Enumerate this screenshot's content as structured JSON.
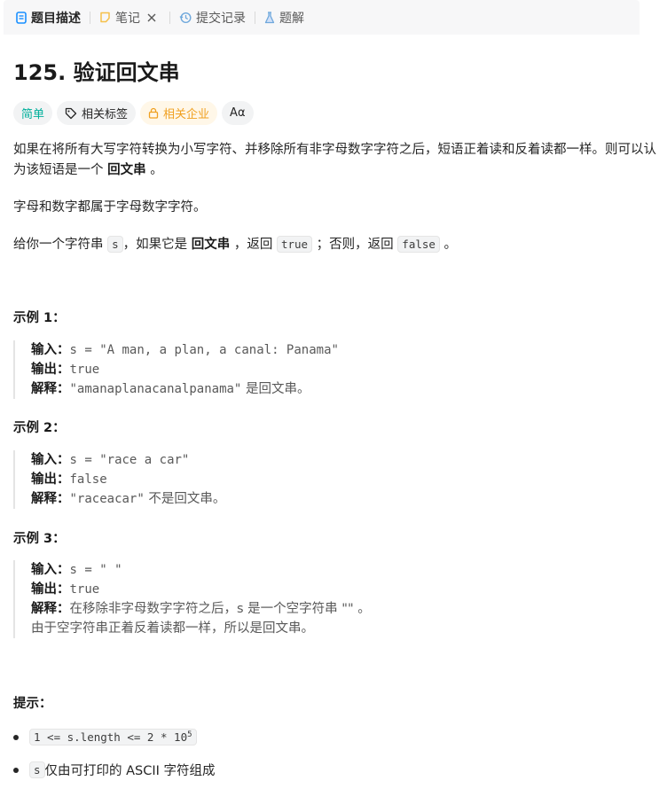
{
  "tabs": [
    {
      "label": "题目描述",
      "icon": "document-icon",
      "active": true
    },
    {
      "label": "笔记",
      "icon": "note-icon",
      "closable": true
    },
    {
      "label": "提交记录",
      "icon": "history-icon"
    },
    {
      "label": "题解",
      "icon": "flask-icon"
    }
  ],
  "problem": {
    "title": "125. 验证回文串",
    "tags": {
      "difficulty": "简单",
      "related_tags": "相关标签",
      "related_companies": "相关企业",
      "translate_icon": "Aα"
    },
    "desc1_part1": "如果在将所有大写字符转换为小写字符、并移除所有非字母数字字符之后，短语正着读和反着读都一样。则可以认为该短语是一个 ",
    "desc1_bold": "回文串",
    "desc1_end": " 。",
    "desc2": "字母和数字都属于字母数字字符。",
    "desc3_part1": "给你一个字符串 ",
    "desc3_code1": "s",
    "desc3_part2": "，如果它是 ",
    "desc3_bold": "回文串",
    "desc3_part3": " ，返回 ",
    "desc3_code2": "true",
    "desc3_part4": " ；否则，返回 ",
    "desc3_code3": "false",
    "desc3_end": " 。"
  },
  "labels": {
    "input": "输入：",
    "output": "输出：",
    "explain": "解释："
  },
  "examples": [
    {
      "title": "示例 1：",
      "input": "s = \"A man, a plan, a canal: Panama\"",
      "output": "true",
      "explain_code": "\"amanaplanacanalpanama\"",
      "explain_text": " 是回文串。"
    },
    {
      "title": "示例 2：",
      "input": "s = \"race a car\"",
      "output": "false",
      "explain_code": "\"raceacar\"",
      "explain_text": " 不是回文串。"
    },
    {
      "title": "示例 3：",
      "input": "s = \" \"",
      "output": "true",
      "explain_text1": "在移除非字母数字字符之后，s 是一个空字符串 \"\" 。",
      "explain_text2": "由于空字符串正着反着读都一样，所以是回文串。"
    }
  ],
  "hints": {
    "title": "提示：",
    "item1_code": "1 <= s.length <= 2 * 10",
    "item1_sup": "5",
    "item2_code": "s",
    "item2_text": " 仅由可打印的 ASCII 字符组成"
  },
  "colors": {
    "easy": "#00af9b",
    "company": "#f0a020",
    "active_tab_icon": "#1a90ff"
  }
}
